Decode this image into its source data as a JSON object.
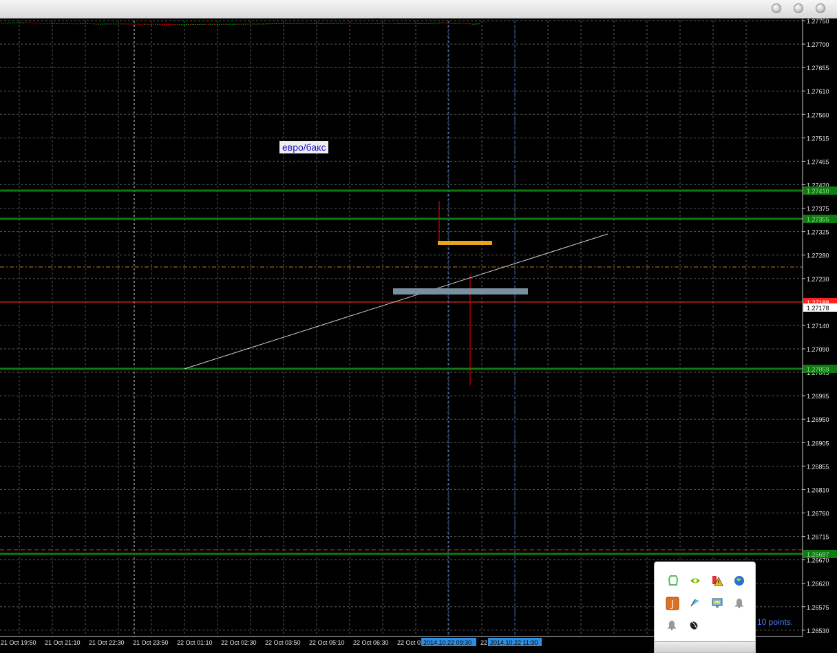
{
  "window": {
    "controls": [
      "minimize",
      "zoom",
      "close"
    ]
  },
  "chart": {
    "symbol_label": "евро/бакс",
    "points_text": "10 points.",
    "price_axis": {
      "ticks": [
        "1.27750",
        "1.27700",
        "1.27655",
        "1.27610",
        "1.27560",
        "1.27515",
        "1.27465",
        "1.27420",
        "1.27375",
        "1.27325",
        "1.27280",
        "1.27230",
        "1.27178",
        "1.27140",
        "1.27090",
        "1.27045",
        "1.26995",
        "1.26950",
        "1.26905",
        "1.26855",
        "1.26810",
        "1.26760",
        "1.26715",
        "1.26670",
        "1.26620",
        "1.26575",
        "1.26530"
      ],
      "marker_labels": [
        "1.27410",
        "1.27355",
        "1.27188",
        "1.27178",
        "1.27059",
        "1.26687"
      ]
    },
    "time_axis": {
      "ticks": [
        "21 Oct 19:50",
        "21 Oct 21:10",
        "21 Oct 22:30",
        "21 Oct 23:50",
        "22 Oct 01:10",
        "22 Oct 02:30",
        "22 Oct 03:50",
        "22 Oct 05:10",
        "22 Oct 06:30",
        "22 Oct 07"
      ],
      "highlight_labels": [
        "2014.10.22 09:30",
        "2014.10.22 11:30"
      ],
      "after_label": "22"
    },
    "colors": {
      "bull": "#00b000",
      "bear": "#ff0000",
      "grid": "#5a5a5a",
      "level": "#0f7a0f",
      "bid": "#ff3030"
    }
  },
  "tray": {
    "icons": [
      "evernote-icon",
      "nvidia-icon",
      "security-alert-icon",
      "globe-icon",
      "java-update-icon",
      "wifi-tool-icon",
      "display-icon",
      "notification-bell-icon",
      "notification-bell-icon",
      "mouse-icon"
    ]
  }
}
